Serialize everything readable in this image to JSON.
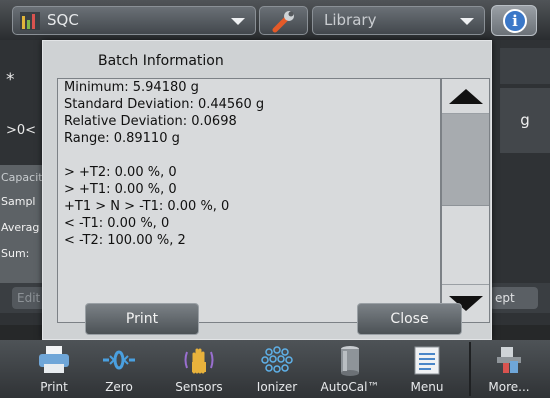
{
  "topbar": {
    "app_name": "SQC",
    "library_label": "Library",
    "accent": "#3b78c8"
  },
  "background": {
    "left_keys": [
      "*",
      ">0<"
    ],
    "labels": [
      "Capacit",
      "Sampl",
      "Averag",
      "Sum:"
    ],
    "unit": "g",
    "edit_label": "Edit S",
    "accept_label": "ept"
  },
  "dialog": {
    "title": "Batch Information",
    "lines": [
      "Minimum: 5.94180 g",
      "Standard Deviation: 0.44560 g",
      "Relative Deviation: 0.0698",
      "Range: 0.89110 g",
      "",
      "> +T2: 0.00 %, 0",
      "> +T1: 0.00 %, 0",
      "+T1 > N > -T1: 0.00 %, 0",
      "< -T1: 0.00 %, 0",
      "< -T2: 100.00 %, 2"
    ],
    "print_label": "Print",
    "close_label": "Close"
  },
  "toolbar": {
    "items": [
      {
        "label": "Print",
        "icon": "printer-icon"
      },
      {
        "label": "Zero",
        "icon": "zero-icon"
      },
      {
        "label": "Sensors",
        "icon": "hand-sensor-icon"
      },
      {
        "label": "Ionizer",
        "icon": "ionizer-icon"
      },
      {
        "label": "AutoCal™",
        "icon": "autocal-weight-icon"
      },
      {
        "label": "Menu",
        "icon": "menu-list-icon"
      },
      {
        "label": "More...",
        "icon": "more-icon"
      }
    ]
  }
}
